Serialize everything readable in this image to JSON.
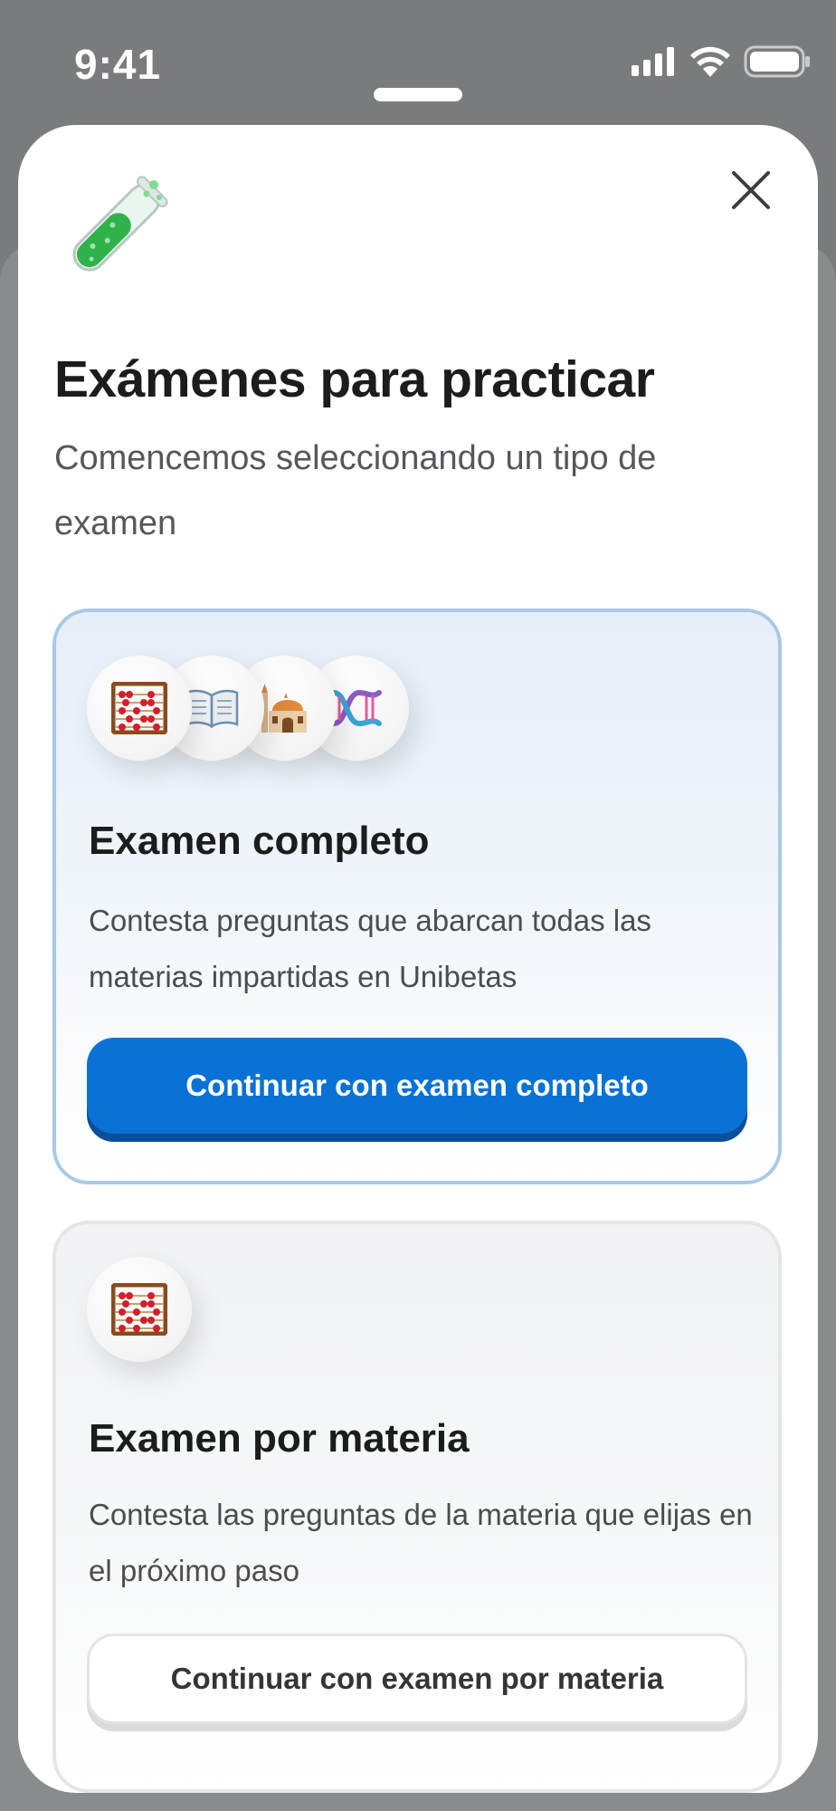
{
  "status_bar": {
    "time": "9:41",
    "icons": [
      "cellular-signal-icon",
      "wifi-icon",
      "battery-icon"
    ]
  },
  "sheet": {
    "close_icon": "close-icon",
    "hero_icon": "test-tube-icon",
    "title": "Exámenes para practicar",
    "subtitle": "Comencemos seleccionando un tipo de examen"
  },
  "cards": [
    {
      "icons": [
        "abacus-icon",
        "open-book-icon",
        "mosque-icon",
        "dna-icon"
      ],
      "title": "Examen completo",
      "description": "Contesta preguntas que abarcan todas las materias impartidas en Unibetas",
      "button_label": "Continuar con examen completo",
      "selected": true
    },
    {
      "icons": [
        "abacus-icon"
      ],
      "title": "Examen por materia",
      "description": "Contesta las preguntas de la materia que elijas en el próximo paso",
      "button_label": "Continuar con examen por materia",
      "selected": false
    }
  ],
  "colors": {
    "primary": "#0a72d6",
    "selected_border": "#a9c9e6",
    "title_text": "#1b1c1e"
  }
}
